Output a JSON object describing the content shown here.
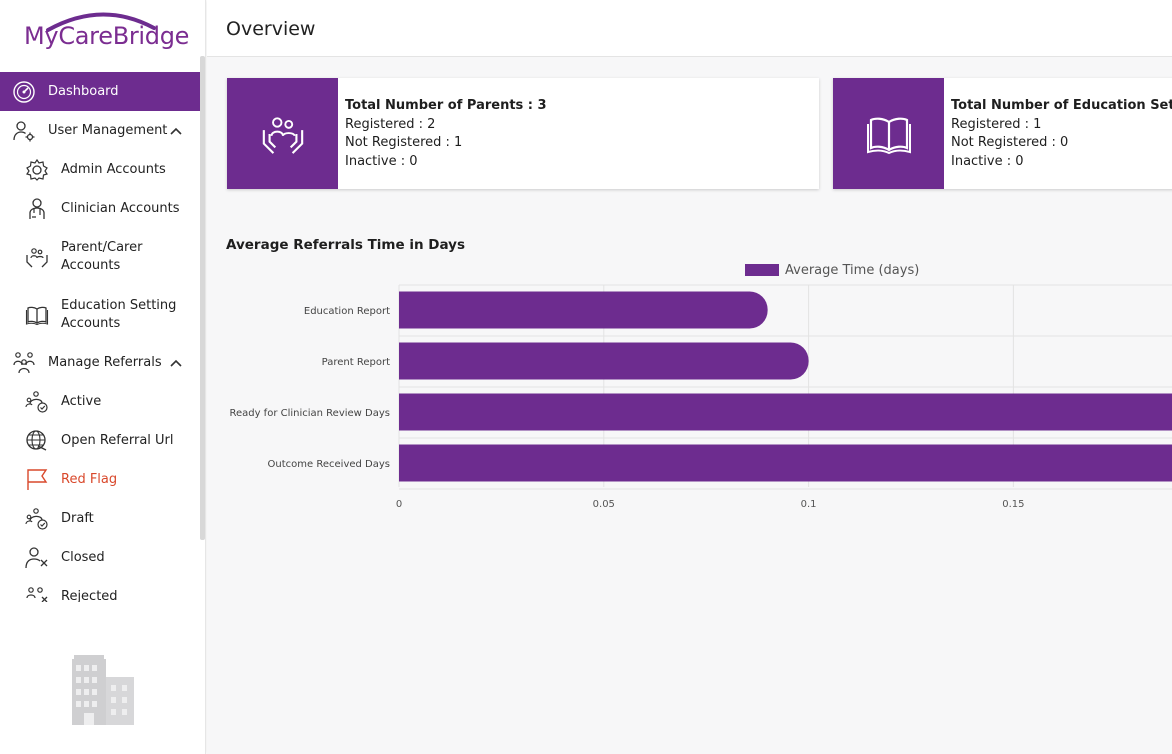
{
  "brand": {
    "name_part1": "My",
    "name_part2": "Care",
    "name_part3": "Bridge",
    "accent_color": "#6d2c8f",
    "alert_color": "#d9482b"
  },
  "sidebar": {
    "items": [
      {
        "label": "Dashboard",
        "icon": "dashboard-gauge-icon",
        "active": true
      },
      {
        "label": "User Management",
        "icon": "user-settings-icon",
        "expanded": true
      },
      {
        "label": "Admin Accounts",
        "icon": "admin-gear-icon"
      },
      {
        "label": "Clinician Accounts",
        "icon": "clinician-icon"
      },
      {
        "label": "Parent/Carer Accounts",
        "icon": "parent-hands-icon"
      },
      {
        "label": "Education Setting Accounts",
        "icon": "book-icon"
      },
      {
        "label": "Manage Referrals",
        "icon": "referrals-icon",
        "expanded": true
      },
      {
        "label": "Active",
        "icon": "active-referral-icon"
      },
      {
        "label": "Open Referral Url",
        "icon": "globe-link-icon"
      },
      {
        "label": "Red Flag",
        "icon": "flag-icon"
      },
      {
        "label": "Draft",
        "icon": "draft-referral-icon"
      },
      {
        "label": "Closed",
        "icon": "closed-user-icon"
      },
      {
        "label": "Rejected",
        "icon": "rejected-icon"
      }
    ]
  },
  "header": {
    "title": "Overview"
  },
  "cards": [
    {
      "title": "Total Number of Parents : 3",
      "registered": "Registered : 2",
      "not_registered": "Not Registered : 1",
      "inactive": "Inactive : 0",
      "icon": "parent-hands-icon"
    },
    {
      "title": "Total Number of Education Setting",
      "registered": "Registered : 1",
      "not_registered": "Not Registered : 0",
      "inactive": "Inactive : 0",
      "icon": "book-icon"
    }
  ],
  "chart_section": {
    "title": "Average Referrals Time in Days"
  },
  "chart_data": {
    "type": "bar",
    "orientation": "horizontal",
    "categories": [
      "Education Report",
      "Parent Report",
      "Ready for Clinician Review Days",
      "Outcome Received Days"
    ],
    "series": [
      {
        "name": "Average Time (days)",
        "values": [
          0.09,
          0.1,
          0.2,
          0.2
        ],
        "color": "#6d2c8f"
      }
    ],
    "xticks": [
      "0",
      "0.05",
      "0.1",
      "0.15"
    ],
    "xlim": [
      0,
      0.2
    ],
    "grid": true,
    "legend": "top"
  }
}
